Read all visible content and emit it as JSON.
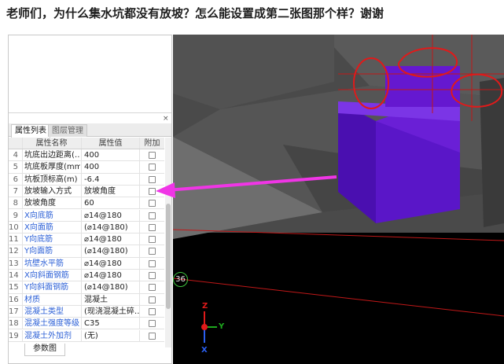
{
  "post": {
    "title": "老师们，为什么集水坑都没有放坡？怎么能设置成第二张图那个样？谢谢"
  },
  "panel": {
    "close_icon": "×",
    "tabs": [
      "属性列表",
      "图层管理"
    ],
    "columns": [
      "属性名称",
      "属性值",
      "附加"
    ],
    "rows": [
      {
        "num": "4",
        "name": "坑底出边距离(…",
        "value": "400",
        "highlight": false
      },
      {
        "num": "5",
        "name": "坑底板厚度(mm)",
        "value": "400",
        "highlight": false
      },
      {
        "num": "6",
        "name": "坑板顶标高(m)",
        "value": "-6.4",
        "highlight": false
      },
      {
        "num": "7",
        "name": "放坡输入方式",
        "value": "放坡角度",
        "highlight": false
      },
      {
        "num": "8",
        "name": "放坡角度",
        "value": "60",
        "highlight": false
      },
      {
        "num": "9",
        "name": "X向底筋",
        "value": "⌀14@180",
        "highlight": true
      },
      {
        "num": "10",
        "name": "X向面筋",
        "value": "(⌀14@180)",
        "highlight": true
      },
      {
        "num": "11",
        "name": "Y向底筋",
        "value": "⌀14@180",
        "highlight": true
      },
      {
        "num": "12",
        "name": "Y向面筋",
        "value": "(⌀14@180)",
        "highlight": true
      },
      {
        "num": "13",
        "name": "坑壁水平筋",
        "value": "⌀14@180",
        "highlight": true
      },
      {
        "num": "14",
        "name": "X向斜面钢筋",
        "value": "⌀14@180",
        "highlight": true
      },
      {
        "num": "15",
        "name": "Y向斜面钢筋",
        "value": "(⌀14@180)",
        "highlight": true
      },
      {
        "num": "16",
        "name": "材质",
        "value": "混凝土",
        "highlight": true
      },
      {
        "num": "17",
        "name": "混凝土类型",
        "value": "(现浇混凝土碎…",
        "highlight": true
      },
      {
        "num": "18",
        "name": "混凝土强度等级",
        "value": "C35",
        "highlight": true
      },
      {
        "num": "19",
        "name": "混凝土外加剂",
        "value": "(无)",
        "highlight": true
      }
    ],
    "bottom_tab": "参数图"
  },
  "viewport": {
    "grid_label": "36",
    "axes": {
      "x": "X",
      "y": "Y",
      "z": "Z"
    }
  },
  "colors": {
    "pit_purple": "#6a1fd6",
    "arrow_magenta": "#f035e6",
    "annotation_red": "#e01a1a",
    "link_blue": "#2b5fd6"
  }
}
